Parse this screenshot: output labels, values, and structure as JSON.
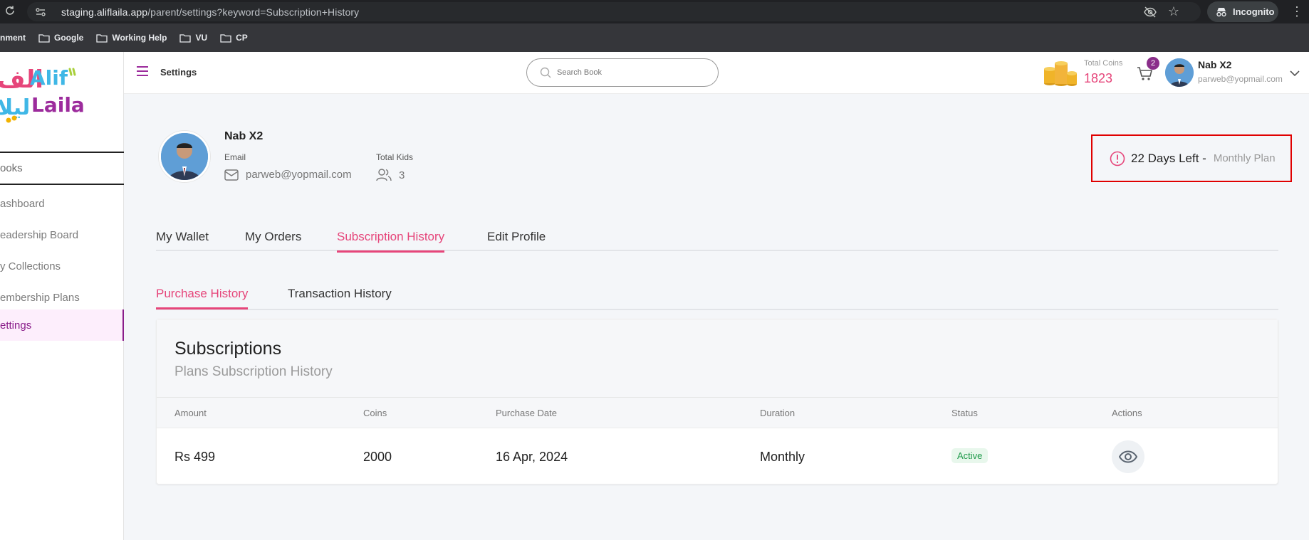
{
  "browser": {
    "url_host": "staging.aliflaila.app",
    "url_path": "/parent/settings?keyword=Subscription+History",
    "incognito_label": "Incognito",
    "bookmarks": [
      {
        "label": "nment"
      },
      {
        "label": "Google"
      },
      {
        "label": "Working Help"
      },
      {
        "label": "VU"
      },
      {
        "label": "CP"
      }
    ]
  },
  "sidebar": {
    "items": [
      {
        "label": "ooks"
      },
      {
        "label": "ashboard"
      },
      {
        "label": "eadership Board"
      },
      {
        "label": "y Collections"
      },
      {
        "label": "embership Plans"
      },
      {
        "label": "ettings"
      }
    ]
  },
  "header": {
    "title": "Settings",
    "search_placeholder": "Search Book",
    "coins_label": "Total Coins",
    "coins_value": "1823",
    "cart_count": "2",
    "user_name": "Nab X2",
    "user_email": "parweb@yopmail.com"
  },
  "profile": {
    "name": "Nab X2",
    "email_label": "Email",
    "email_value": "parweb@yopmail.com",
    "kids_label": "Total Kids",
    "kids_value": "3"
  },
  "plan": {
    "days_left": "22 Days Left -",
    "plan_name": "Monthly Plan"
  },
  "tabs": [
    "My Wallet",
    "My Orders",
    "Subscription History",
    "Edit Profile"
  ],
  "subtabs": [
    "Purchase History",
    "Transaction History"
  ],
  "subscriptions": {
    "title": "Subscriptions",
    "subtitle": "Plans Subscription History",
    "columns": [
      "Amount",
      "Coins",
      "Purchase Date",
      "Duration",
      "Status",
      "Actions"
    ],
    "rows": [
      {
        "amount": "Rs 499",
        "coins": "2000",
        "date": "16 Apr, 2024",
        "duration": "Monthly",
        "status": "Active"
      }
    ]
  },
  "colors": {
    "accent_pink": "#e6457a",
    "brand_purple": "#8a1d8a",
    "status_green": "#1f9a4b",
    "highlight_red": "#e00000"
  }
}
